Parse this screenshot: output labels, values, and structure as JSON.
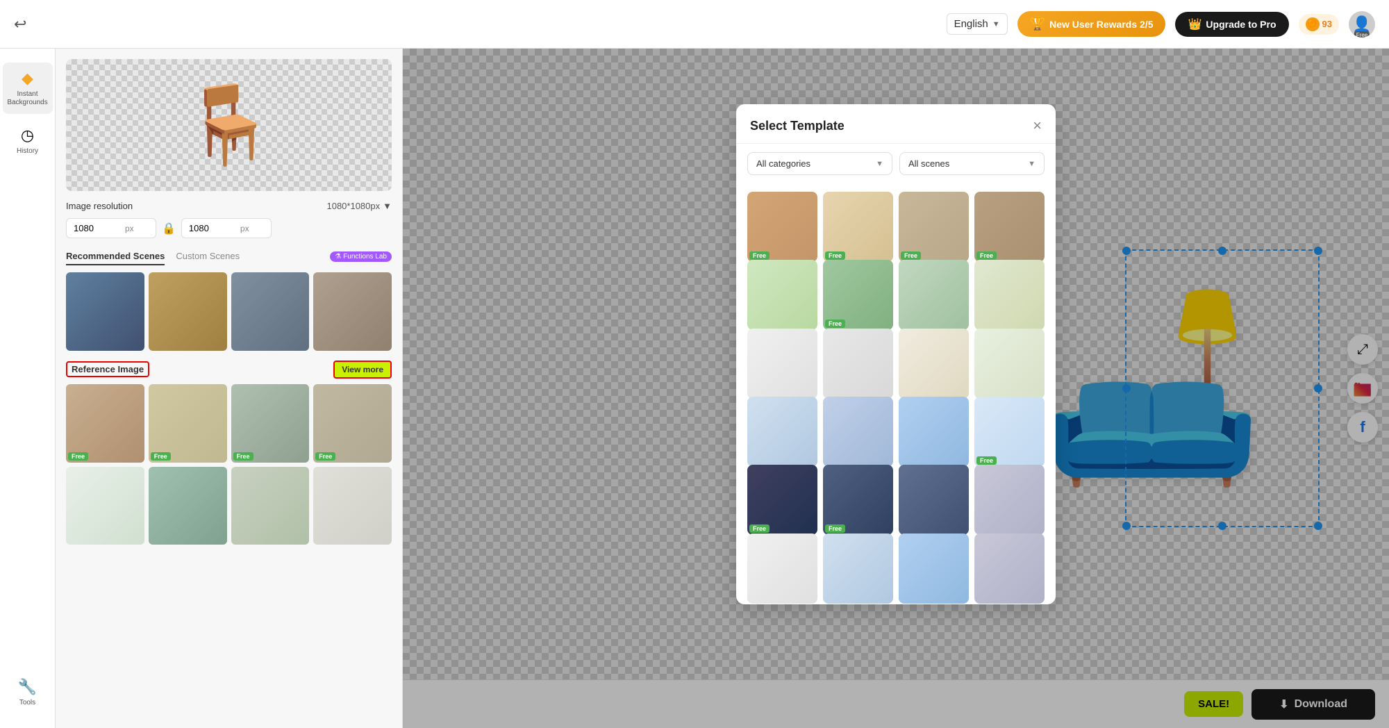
{
  "header": {
    "language": "English",
    "rewards_label": "New User Rewards 2/5",
    "upgrade_label": "Upgrade to Pro",
    "points": "93",
    "avatar_label": "Free",
    "logout_title": "Logout"
  },
  "sidebar": {
    "items": [
      {
        "id": "instant-backgrounds",
        "label": "Instant Backgrounds",
        "icon": "◆",
        "active": true
      },
      {
        "id": "history",
        "label": "History",
        "icon": "◷",
        "active": false
      },
      {
        "id": "tools",
        "label": "Tools",
        "icon": "▲",
        "active": false
      }
    ]
  },
  "left_panel": {
    "resolution_label": "Image resolution",
    "resolution_value": "1080*1080px",
    "width": "1080",
    "height": "1080",
    "px_unit": "px",
    "tabs": [
      {
        "id": "recommended",
        "label": "Recommended Scenes",
        "active": true
      },
      {
        "id": "custom",
        "label": "Custom Scenes",
        "active": false
      }
    ],
    "functions_lab_label": "Functions Lab",
    "reference_image_label": "Reference Image",
    "view_more_label": "View more"
  },
  "modal": {
    "title": "Select Template",
    "close_label": "×",
    "category_placeholder": "All categories",
    "scene_placeholder": "All scenes",
    "category_arrow": "▼",
    "scene_arrow": "▼"
  },
  "bottom_bar": {
    "sale_label": "SALE!",
    "download_label": "Download",
    "download_icon": "⬇"
  },
  "social": {
    "share_icon": "share",
    "instagram_icon": "ig",
    "facebook_icon": "f"
  }
}
